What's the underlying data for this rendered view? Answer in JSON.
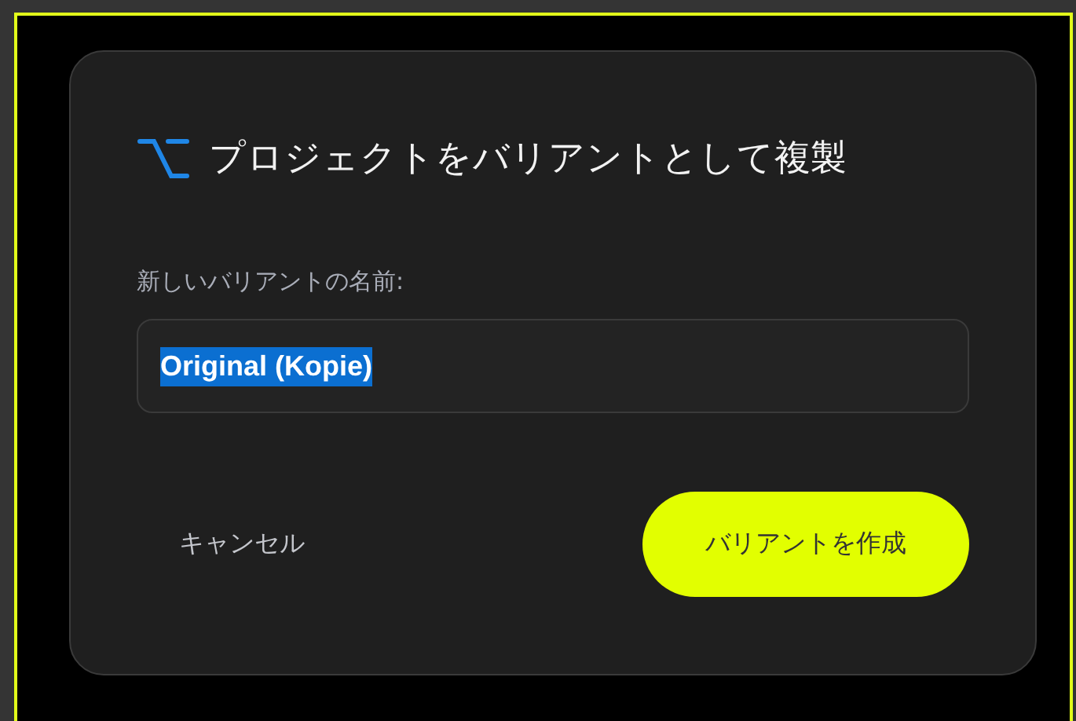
{
  "dialog": {
    "title": "プロジェクトをバリアントとして複製",
    "field": {
      "label": "新しいバリアントの名前:",
      "value": "Original (Kopie)",
      "value_selected": true
    },
    "buttons": [
      {
        "label": "キャンセル",
        "kind": "secondary"
      },
      {
        "label": "バリアントを作成",
        "kind": "primary"
      }
    ]
  }
}
